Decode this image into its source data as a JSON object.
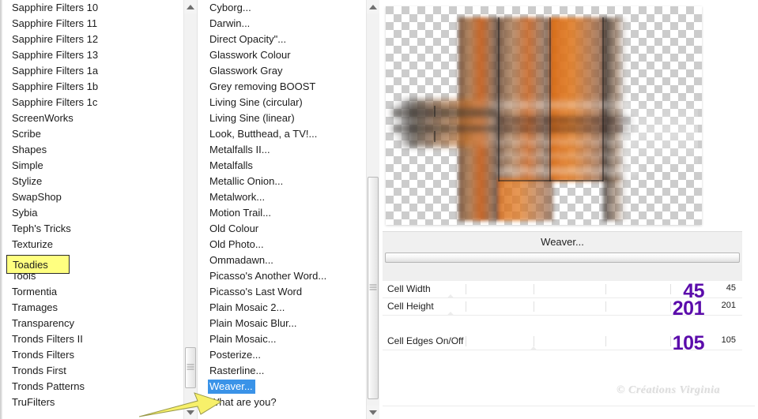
{
  "window": {
    "title": "Weaver...",
    "accent_selection": "#3a93e8",
    "accent_value": "#5b0cab",
    "highlight_color": "#ffff80"
  },
  "category_list": {
    "name": "filter-category-list",
    "items": [
      {
        "label": "Sapphire Filters 10"
      },
      {
        "label": "Sapphire Filters 11"
      },
      {
        "label": "Sapphire Filters 12"
      },
      {
        "label": "Sapphire Filters 13"
      },
      {
        "label": "Sapphire Filters 1a"
      },
      {
        "label": "Sapphire Filters 1b"
      },
      {
        "label": "Sapphire Filters 1c"
      },
      {
        "label": "ScreenWorks"
      },
      {
        "label": "Scribe"
      },
      {
        "label": "Shapes"
      },
      {
        "label": "Simple"
      },
      {
        "label": "Stylize"
      },
      {
        "label": "SwapShop"
      },
      {
        "label": "Sybia"
      },
      {
        "label": "Teph's Tricks"
      },
      {
        "label": "Texturize"
      },
      {
        "label": "Toadies"
      },
      {
        "label": "Tools"
      },
      {
        "label": "Tormentia"
      },
      {
        "label": "Tramages"
      },
      {
        "label": "Transparency"
      },
      {
        "label": "Tronds Filters II"
      },
      {
        "label": "Tronds Filters"
      },
      {
        "label": "Tronds First"
      },
      {
        "label": "Tronds Patterns"
      },
      {
        "label": "TruFilters"
      }
    ],
    "highlighted_label": "Toadies"
  },
  "filter_list": {
    "name": "filter-effect-list",
    "items": [
      {
        "label": "Cyborg..."
      },
      {
        "label": "Darwin..."
      },
      {
        "label": "Direct Opacity\"..."
      },
      {
        "label": "Glasswork Colour"
      },
      {
        "label": "Glasswork Gray"
      },
      {
        "label": "Grey removing BOOST"
      },
      {
        "label": "Living Sine (circular)"
      },
      {
        "label": "Living Sine (linear)"
      },
      {
        "label": "Look, Butthead, a TV!..."
      },
      {
        "label": "Metalfalls II..."
      },
      {
        "label": "Metalfalls"
      },
      {
        "label": "Metallic Onion..."
      },
      {
        "label": "Metalwork..."
      },
      {
        "label": "Motion Trail..."
      },
      {
        "label": "Old Colour"
      },
      {
        "label": "Old Photo..."
      },
      {
        "label": "Ommadawn..."
      },
      {
        "label": "Picasso's Another Word..."
      },
      {
        "label": "Picasso's Last Word"
      },
      {
        "label": "Plain Mosaic 2..."
      },
      {
        "label": "Plain Mosaic Blur..."
      },
      {
        "label": "Plain Mosaic..."
      },
      {
        "label": "Posterize..."
      },
      {
        "label": "Rasterline..."
      },
      {
        "label": "Weaver..."
      },
      {
        "label": "What are you?"
      }
    ],
    "selected_label": "Weaver..."
  },
  "settings_panel": {
    "title": "Weaver...",
    "sliders": [
      {
        "name": "Cell Width",
        "value": "45",
        "readout": "45",
        "marker_pct": 19
      },
      {
        "name": "Cell Height",
        "value": "201",
        "readout": "201",
        "marker_pct": 19
      },
      {
        "name": "Cell Edges On/Off",
        "value": "105",
        "readout": "105",
        "marker_pct": 42
      }
    ]
  },
  "watermark": {
    "text": "© Créations Virginia"
  },
  "icons": {
    "scroll_up": "triangle-up-icon",
    "scroll_down": "triangle-down-icon",
    "grip": "grip-lines-icon",
    "pointer_arrow": "yellow-arrow-annotation"
  }
}
